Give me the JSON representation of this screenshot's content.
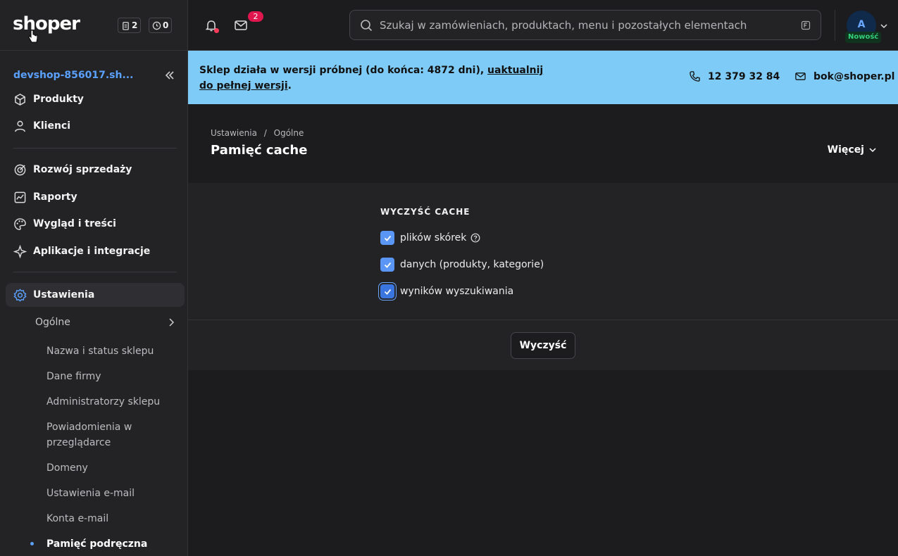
{
  "topbar": {
    "logo": "shoper",
    "counter_orders": "2",
    "counter_pending": "0",
    "mail_badge": "2",
    "search_placeholder": "Szukaj w zamówieniach, produktach, menu i pozostałych elementach",
    "avatar_letter": "A",
    "badge_new": "Nowość"
  },
  "sidebar": {
    "shop_name": "devshop-856017.sh...",
    "items": [
      {
        "label": "Produkty",
        "icon": "box-icon"
      },
      {
        "label": "Klienci",
        "icon": "user-icon"
      },
      {
        "label": "Rozwój sprzedaży",
        "icon": "target-icon"
      },
      {
        "label": "Raporty",
        "icon": "chart-icon"
      },
      {
        "label": "Wygląd i treści",
        "icon": "palette-icon"
      },
      {
        "label": "Aplikacje i integracje",
        "icon": "sparkle-icon"
      },
      {
        "label": "Ustawienia",
        "icon": "gear-icon"
      }
    ],
    "submenu": {
      "label": "Ogólne",
      "leaves": [
        "Nazwa i status sklepu",
        "Dane firmy",
        "Administratorzy sklepu",
        "Powiadomienia w przeglądarce",
        "Domeny",
        "Ustawienia e-mail",
        "Konta e-mail",
        "Pamięć podręczna"
      ]
    }
  },
  "banner": {
    "text": "Sklep działa w wersji próbnej (do końca: 4872 dni), ",
    "link": "uaktualnij do pełnej wersji",
    "suffix": ".",
    "phone": "12 379 32 84",
    "email": "bok@shoper.pl"
  },
  "page": {
    "breadcrumb_root": "Ustawienia",
    "breadcrumb_sep": "/",
    "breadcrumb_current": "Ogólne",
    "title": "Pamięć cache",
    "more": "Więcej"
  },
  "cache": {
    "section_title": "WYCZYŚĆ CACHE",
    "options": [
      {
        "label": "plików skórek",
        "checked": true
      },
      {
        "label": "danych (produkty, kategorie)",
        "checked": true
      },
      {
        "label": "wyników wyszukiwania",
        "checked": true
      }
    ],
    "button": "Wyczyść"
  },
  "colors": {
    "accent": "#5aa0ff",
    "banner": "#7fcbf7",
    "checkbox": "#5a96f5",
    "badge": "#e0174f"
  }
}
